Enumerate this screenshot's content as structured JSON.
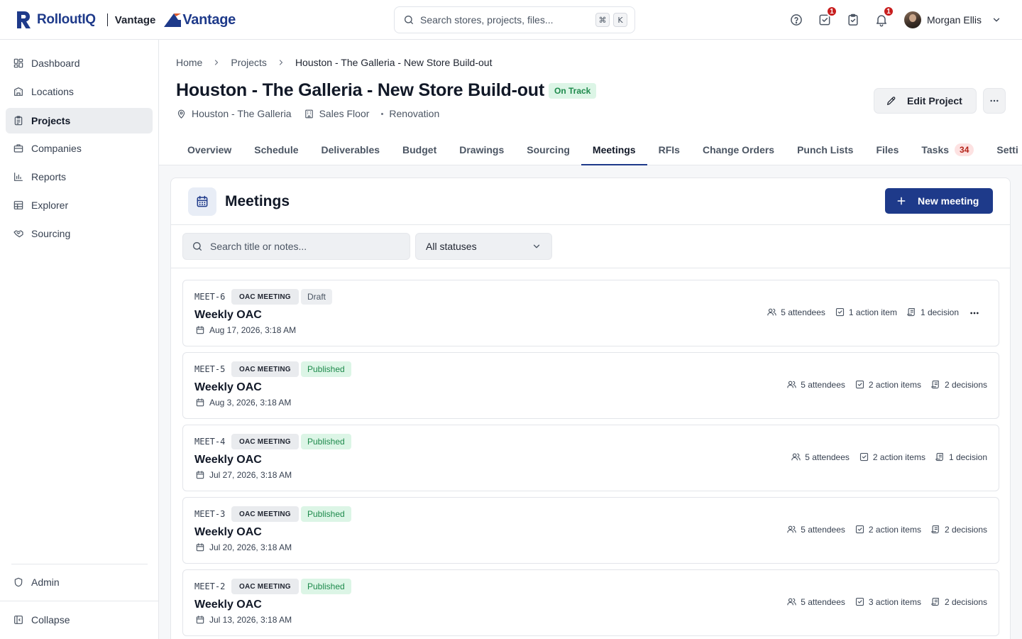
{
  "brand": {
    "logo_text": "RolloutIQ",
    "divider_label": "Vantage",
    "partner_logo_text": "Vantage",
    "accent": "#1e3a8a"
  },
  "topbar": {
    "search_placeholder": "Search stores, projects, files...",
    "shortcut_keys": [
      "⌘",
      "K"
    ],
    "icons": [
      "help-icon",
      "task-check-icon",
      "clipboard-check-icon",
      "bell-icon"
    ],
    "tasks_badge": "1",
    "notifications_badge": "1",
    "user_name": "Morgan Ellis"
  },
  "sidebar": {
    "items": [
      {
        "label": "Dashboard",
        "icon": "dashboard-icon"
      },
      {
        "label": "Locations",
        "icon": "building-icon"
      },
      {
        "label": "Projects",
        "icon": "clipboard-icon",
        "active": true
      },
      {
        "label": "Companies",
        "icon": "briefcase-icon"
      },
      {
        "label": "Reports",
        "icon": "bar-chart-icon"
      },
      {
        "label": "Explorer",
        "icon": "table-icon"
      },
      {
        "label": "Sourcing",
        "icon": "handshake-icon"
      }
    ],
    "admin_label": "Admin",
    "collapse_label": "Collapse"
  },
  "header": {
    "breadcrumb": [
      "Home",
      "Projects",
      "Houston - The Galleria - New Store Build-out"
    ],
    "title": "Houston - The Galleria - New Store Build-out",
    "status": "On Track",
    "location": "Houston - The Galleria",
    "area": "Sales Floor",
    "project_type": "Renovation",
    "edit_label": "Edit Project"
  },
  "tabs": [
    {
      "label": "Overview"
    },
    {
      "label": "Schedule"
    },
    {
      "label": "Deliverables"
    },
    {
      "label": "Budget"
    },
    {
      "label": "Drawings"
    },
    {
      "label": "Sourcing"
    },
    {
      "label": "Meetings",
      "active": true
    },
    {
      "label": "RFIs"
    },
    {
      "label": "Change Orders"
    },
    {
      "label": "Punch Lists"
    },
    {
      "label": "Files"
    },
    {
      "label": "Tasks",
      "count": "34"
    },
    {
      "label": "Setti"
    }
  ],
  "meetings_section": {
    "title": "Meetings",
    "new_button": "New meeting",
    "search_placeholder": "Search title or notes...",
    "status_filter": "All statuses"
  },
  "meetings": [
    {
      "id": "MEET-6",
      "type": "OAC MEETING",
      "status": "Draft",
      "title": "Weekly OAC",
      "date": "Aug 17, 2026, 3:18 AM",
      "attendees": "5 attendees",
      "action_items": "1 action item",
      "decisions": "1 decision"
    },
    {
      "id": "MEET-5",
      "type": "OAC MEETING",
      "status": "Published",
      "title": "Weekly OAC",
      "date": "Aug 3, 2026, 3:18 AM",
      "attendees": "5 attendees",
      "action_items": "2 action items",
      "decisions": "2 decisions"
    },
    {
      "id": "MEET-4",
      "type": "OAC MEETING",
      "status": "Published",
      "title": "Weekly OAC",
      "date": "Jul 27, 2026, 3:18 AM",
      "attendees": "5 attendees",
      "action_items": "2 action items",
      "decisions": "1 decision"
    },
    {
      "id": "MEET-3",
      "type": "OAC MEETING",
      "status": "Published",
      "title": "Weekly OAC",
      "date": "Jul 20, 2026, 3:18 AM",
      "attendees": "5 attendees",
      "action_items": "2 action items",
      "decisions": "2 decisions"
    },
    {
      "id": "MEET-2",
      "type": "OAC MEETING",
      "status": "Published",
      "title": "Weekly OAC",
      "date": "Jul 13, 2026, 3:18 AM",
      "attendees": "5 attendees",
      "action_items": "3 action items",
      "decisions": "2 decisions"
    }
  ]
}
